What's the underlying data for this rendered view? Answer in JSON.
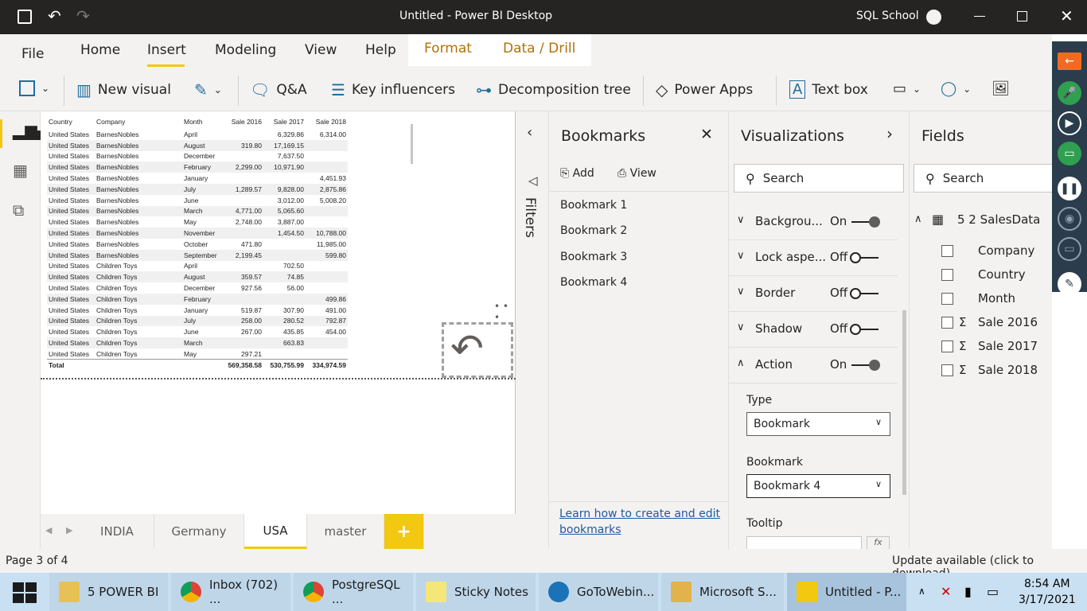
{
  "window": {
    "title": "Untitled - Power BI Desktop",
    "user": "SQL School"
  },
  "ribbon": {
    "tabs": [
      "File",
      "Home",
      "Insert",
      "Modeling",
      "View",
      "Help",
      "Format",
      "Data / Drill"
    ],
    "active_tab": "Insert",
    "toolbar": {
      "new_visual": "New visual",
      "qa": "Q&A",
      "key_influencers": "Key influencers",
      "decomposition_tree": "Decomposition tree",
      "power_apps": "Power Apps",
      "text_box": "Text box"
    }
  },
  "table_visual": {
    "headers": [
      "Country",
      "Company",
      "Month",
      "Sale 2016",
      "Sale 2017",
      "Sale 2018"
    ],
    "rows": [
      [
        "United States",
        "BarnesNobles",
        "April",
        "",
        "6,329.86",
        "6,314.00"
      ],
      [
        "United States",
        "BarnesNobles",
        "August",
        "319.80",
        "17,169.15",
        ""
      ],
      [
        "United States",
        "BarnesNobles",
        "December",
        "",
        "7,637.50",
        ""
      ],
      [
        "United States",
        "BarnesNobles",
        "February",
        "2,299.00",
        "10,971.90",
        ""
      ],
      [
        "United States",
        "BarnesNobles",
        "January",
        "",
        "",
        "4,451.93"
      ],
      [
        "United States",
        "BarnesNobles",
        "July",
        "1,289.57",
        "9,828.00",
        "2,875.86"
      ],
      [
        "United States",
        "BarnesNobles",
        "June",
        "",
        "3,012.00",
        "5,008.20"
      ],
      [
        "United States",
        "BarnesNobles",
        "March",
        "4,771.00",
        "5,065.60",
        ""
      ],
      [
        "United States",
        "BarnesNobles",
        "May",
        "2,748.00",
        "3,887.00",
        ""
      ],
      [
        "United States",
        "BarnesNobles",
        "November",
        "",
        "1,454.50",
        "10,788.00"
      ],
      [
        "United States",
        "BarnesNobles",
        "October",
        "471.80",
        "",
        "11,985.00"
      ],
      [
        "United States",
        "BarnesNobles",
        "September",
        "2,199.45",
        "",
        "599.80"
      ],
      [
        "United States",
        "Children Toys",
        "April",
        "",
        "702.50",
        ""
      ],
      [
        "United States",
        "Children Toys",
        "August",
        "359.57",
        "74.85",
        ""
      ],
      [
        "United States",
        "Children Toys",
        "December",
        "927.56",
        "56.00",
        ""
      ],
      [
        "United States",
        "Children Toys",
        "February",
        "",
        "",
        "499.86"
      ],
      [
        "United States",
        "Children Toys",
        "January",
        "519.87",
        "307.90",
        "491.00"
      ],
      [
        "United States",
        "Children Toys",
        "July",
        "258.00",
        "280.52",
        "792.87"
      ],
      [
        "United States",
        "Children Toys",
        "June",
        "267.00",
        "435.85",
        "454.00"
      ],
      [
        "United States",
        "Children Toys",
        "March",
        "",
        "663.83",
        ""
      ],
      [
        "United States",
        "Children Toys",
        "May",
        "297.21",
        "",
        ""
      ]
    ],
    "total": [
      "Total",
      "",
      "",
      "569,358.58",
      "530,755.99",
      "334,974.59"
    ]
  },
  "filters_label": "Filters",
  "bookmarks": {
    "title": "Bookmarks",
    "add": "Add",
    "view": "View",
    "items": [
      "Bookmark 1",
      "Bookmark 2",
      "Bookmark 3",
      "Bookmark 4"
    ],
    "help_link": "Learn how to create and edit bookmarks"
  },
  "visualizations": {
    "title": "Visualizations",
    "search_placeholder": "Search",
    "rows": [
      {
        "label": "Backgrou...",
        "state": "On"
      },
      {
        "label": "Lock aspe...",
        "state": "Off"
      },
      {
        "label": "Border",
        "state": "Off"
      },
      {
        "label": "Shadow",
        "state": "Off"
      },
      {
        "label": "Action",
        "state": "On"
      }
    ],
    "type_label": "Type",
    "type_value": "Bookmark",
    "bookmark_label": "Bookmark",
    "bookmark_value": "Bookmark 4",
    "tooltip_label": "Tooltip",
    "fx": "fx"
  },
  "fields": {
    "title": "Fields",
    "search_placeholder": "Search",
    "table_name": "5 2 SalesData",
    "items": [
      {
        "name": "Company",
        "sigma": ""
      },
      {
        "name": "Country",
        "sigma": ""
      },
      {
        "name": "Month",
        "sigma": ""
      },
      {
        "name": "Sale 2016",
        "sigma": "Σ"
      },
      {
        "name": "Sale 2017",
        "sigma": "Σ"
      },
      {
        "name": "Sale 2018",
        "sigma": "Σ"
      }
    ]
  },
  "page_tabs": {
    "tabs": [
      "INDIA",
      "Germany",
      "USA",
      "master"
    ],
    "active": "USA",
    "add": "+"
  },
  "status": {
    "page": "Page 3 of 4",
    "update": "Update available (click to download)"
  },
  "taskbar": {
    "items": [
      "5 POWER BI",
      "Inbox (702) ...",
      "PostgreSQL ...",
      "Sticky Notes",
      "GoToWebin...",
      "Microsoft S...",
      "Untitled - P..."
    ],
    "time": "8:54 AM",
    "date": "3/17/2021"
  },
  "colors": {
    "accent_yellow": "#f2c811",
    "title_bar": "#252423",
    "taskbar": "#c9e0f2"
  }
}
